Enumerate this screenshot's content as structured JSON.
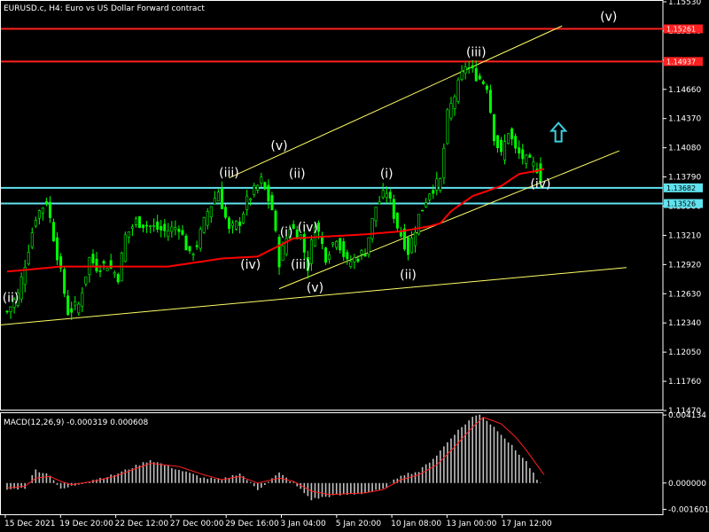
{
  "window": {
    "symbol_title": "EURUSD.c, H4:  Euro vs US Dollar Forward contract"
  },
  "colors": {
    "background": "#000000",
    "frame": "#ffffff",
    "candle": "#00ff00",
    "ma_line": "#ff0000",
    "trend_line": "#ffff66",
    "resistance_line": "#ff2020",
    "support_line": "#5fe3ef",
    "macd_hist": "#c0c0c0",
    "macd_signal": "#ff2020",
    "arrow": "#3ad0e0"
  },
  "chart_data": [
    {
      "type": "candlestick",
      "title": "EURUSD.c, H4:  Euro vs US Dollar Forward contract",
      "x_tick_labels": [
        "15 Dec 2021",
        "19 Dec 20:00",
        "22 Dec 12:00",
        "27 Dec 00:00",
        "29 Dec 16:00",
        "3 Jan 04:00",
        "5 Jan 20:00",
        "10 Jan 08:00",
        "13 Jan 00:00",
        "17 Jan 12:00"
      ],
      "y_tick_labels": [
        "1.15530",
        "1.15240",
        "1.14950",
        "1.14660",
        "1.14370",
        "1.14080",
        "1.13790",
        "1.13500",
        "1.13210",
        "1.12920",
        "1.12630",
        "1.12340",
        "1.12050",
        "1.11760",
        "1.11470"
      ],
      "ylim": [
        1.1147,
        1.1553
      ],
      "bars": 150,
      "close_path": [
        [
          0,
          1.1245
        ],
        [
          3,
          1.1262
        ],
        [
          8,
          1.134
        ],
        [
          11,
          1.1355
        ],
        [
          14,
          1.1302
        ],
        [
          17,
          1.1245
        ],
        [
          20,
          1.1252
        ],
        [
          23,
          1.1298
        ],
        [
          25,
          1.129
        ],
        [
          28,
          1.1292
        ],
        [
          31,
          1.128
        ],
        [
          33,
          1.132
        ],
        [
          36,
          1.1335
        ],
        [
          40,
          1.133
        ],
        [
          44,
          1.1325
        ],
        [
          48,
          1.133
        ],
        [
          51,
          1.13
        ],
        [
          53,
          1.1312
        ],
        [
          56,
          1.1345
        ],
        [
          59,
          1.1365
        ],
        [
          62,
          1.1325
        ],
        [
          65,
          1.1335
        ],
        [
          67,
          1.1355
        ],
        [
          71,
          1.1375
        ],
        [
          74,
          1.1347
        ],
        [
          76,
          1.1295
        ],
        [
          79,
          1.133
        ],
        [
          82,
          1.132
        ],
        [
          84,
          1.129
        ],
        [
          86,
          1.1335
        ],
        [
          89,
          1.13
        ],
        [
          92,
          1.132
        ],
        [
          95,
          1.1293
        ],
        [
          98,
          1.13
        ],
        [
          100,
          1.1305
        ],
        [
          103,
          1.135
        ],
        [
          106,
          1.1365
        ],
        [
          109,
          1.133
        ],
        [
          112,
          1.1305
        ],
        [
          115,
          1.134
        ],
        [
          118,
          1.1365
        ],
        [
          121,
          1.1375
        ],
        [
          123,
          1.144
        ],
        [
          126,
          1.147
        ],
        [
          128,
          1.149
        ],
        [
          131,
          1.148
        ],
        [
          134,
          1.147
        ],
        [
          136,
          1.142
        ],
        [
          138,
          1.14
        ],
        [
          140,
          1.1425
        ],
        [
          142,
          1.1405
        ],
        [
          145,
          1.1395
        ],
        [
          148,
          1.1388
        ],
        [
          150,
          1.137
        ]
      ],
      "moving_average": [
        [
          0,
          1.1285
        ],
        [
          15,
          1.129
        ],
        [
          30,
          1.129
        ],
        [
          45,
          1.129
        ],
        [
          60,
          1.1298
        ],
        [
          70,
          1.13
        ],
        [
          80,
          1.1318
        ],
        [
          90,
          1.132
        ],
        [
          100,
          1.1322
        ],
        [
          110,
          1.1325
        ],
        [
          118,
          1.133
        ],
        [
          121,
          1.1333
        ],
        [
          124,
          1.1345
        ],
        [
          130,
          1.136
        ],
        [
          138,
          1.137
        ],
        [
          143,
          1.1382
        ],
        [
          148,
          1.1385
        ],
        [
          150,
          1.1387
        ]
      ],
      "horizontal_lines": [
        {
          "kind": "resistance",
          "price": 1.15261,
          "label": "1.15261"
        },
        {
          "kind": "resistance",
          "price": 1.14937,
          "label": "1.14937"
        },
        {
          "kind": "support",
          "price": 1.13682,
          "label": "1.13682"
        },
        {
          "kind": "support",
          "price": 1.13526,
          "label": "1.13526"
        }
      ],
      "trend_lines": [
        {
          "from": [
            -2,
            1.1232
          ],
          "to": [
            173,
            1.1289
          ]
        },
        {
          "from": [
            62,
            1.1378
          ],
          "to": [
            155,
            1.1529
          ]
        },
        {
          "from": [
            76,
            1.1268
          ],
          "to": [
            171,
            1.1405
          ]
        }
      ],
      "wave_labels": [
        {
          "text": "(ii)",
          "bar": 1,
          "price": 1.1255
        },
        {
          "text": "(iii)",
          "bar": 62,
          "price": 1.1379
        },
        {
          "text": "(iv)",
          "bar": 68,
          "price": 1.1288
        },
        {
          "text": "(v)",
          "bar": 76,
          "price": 1.1406
        },
        {
          "text": "(ii)",
          "bar": 81,
          "price": 1.1378
        },
        {
          "text": "(i)",
          "bar": 78,
          "price": 1.132
        },
        {
          "text": "(iv)",
          "bar": 84,
          "price": 1.1325
        },
        {
          "text": "(iii)",
          "bar": 82,
          "price": 1.1288
        },
        {
          "text": "(v)",
          "bar": 86,
          "price": 1.1265
        },
        {
          "text": "(i)",
          "bar": 106,
          "price": 1.1378
        },
        {
          "text": "(ii)",
          "bar": 112,
          "price": 1.1278
        },
        {
          "text": "(iii)",
          "bar": 131,
          "price": 1.1499
        },
        {
          "text": "(iv)",
          "bar": 149,
          "price": 1.1368
        },
        {
          "text": "(v)",
          "bar": 168,
          "price": 1.1534
        }
      ],
      "arrow": {
        "direction": "up",
        "bar": 154,
        "price": 1.1423
      }
    },
    {
      "type": "bar",
      "title": "MACD(12,26,9) -0.000319 0.000608",
      "y_tick_labels": [
        "0.004134",
        "0.000000",
        "-0.001601"
      ],
      "ylim": [
        -0.0019,
        0.0043
      ],
      "histogram_path": [
        [
          0,
          -0.0004
        ],
        [
          5,
          -0.0003
        ],
        [
          8,
          0.0008
        ],
        [
          12,
          0.0005
        ],
        [
          15,
          -0.0004
        ],
        [
          18,
          -0.0002
        ],
        [
          24,
          0.0002
        ],
        [
          30,
          0.0005
        ],
        [
          40,
          0.0014
        ],
        [
          48,
          0.0008
        ],
        [
          55,
          0.0003
        ],
        [
          60,
          0.0002
        ],
        [
          65,
          0.0006
        ],
        [
          70,
          -0.0004
        ],
        [
          76,
          0.0006
        ],
        [
          80,
          0.0
        ],
        [
          85,
          -0.001
        ],
        [
          90,
          -0.0008
        ],
        [
          100,
          -0.0006
        ],
        [
          105,
          -0.0004
        ],
        [
          110,
          0.0005
        ],
        [
          115,
          0.0007
        ],
        [
          120,
          0.0017
        ],
        [
          125,
          0.003
        ],
        [
          130,
          0.004
        ],
        [
          132,
          0.0042
        ],
        [
          138,
          0.003
        ],
        [
          142,
          0.002
        ],
        [
          145,
          0.0013
        ],
        [
          148,
          0.0002
        ],
        [
          150,
          -0.0003
        ]
      ],
      "signal_path": [
        [
          0,
          -0.0003
        ],
        [
          5,
          -0.0002
        ],
        [
          8,
          0.0003
        ],
        [
          12,
          0.0004
        ],
        [
          15,
          0.0001
        ],
        [
          18,
          -0.0001
        ],
        [
          24,
          0.0001
        ],
        [
          30,
          0.0004
        ],
        [
          40,
          0.0012
        ],
        [
          48,
          0.001
        ],
        [
          55,
          0.0005
        ],
        [
          60,
          0.0002
        ],
        [
          65,
          0.0004
        ],
        [
          70,
          0.0
        ],
        [
          76,
          0.0003
        ],
        [
          80,
          0.0001
        ],
        [
          85,
          -0.0005
        ],
        [
          90,
          -0.0007
        ],
        [
          100,
          -0.0006
        ],
        [
          105,
          -0.0004
        ],
        [
          110,
          0.0002
        ],
        [
          115,
          0.0005
        ],
        [
          120,
          0.0011
        ],
        [
          125,
          0.0022
        ],
        [
          130,
          0.0034
        ],
        [
          133,
          0.004
        ],
        [
          138,
          0.0036
        ],
        [
          142,
          0.0028
        ],
        [
          145,
          0.002
        ],
        [
          148,
          0.0011
        ],
        [
          150,
          0.0005
        ]
      ]
    }
  ]
}
